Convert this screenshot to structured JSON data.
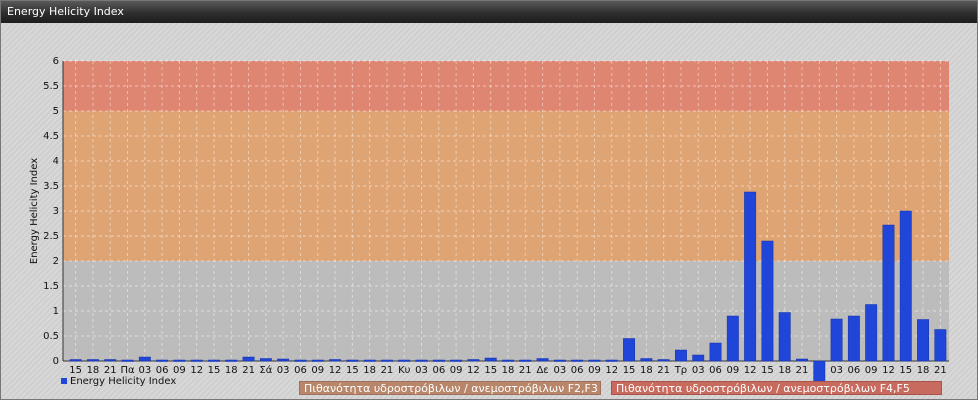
{
  "window": {
    "title": "Energy Helicity Index"
  },
  "chart_data": {
    "type": "bar",
    "ylabel": "Energy Helicity Index",
    "xlabel": "",
    "ylim": [
      0,
      6
    ],
    "yticks": [
      "0",
      "0.5",
      "1",
      "1.5",
      "2",
      "2.5",
      "3",
      "3.5",
      "4",
      "4.5",
      "5",
      "5.5",
      "6"
    ],
    "categories": [
      "15",
      "18",
      "21",
      "Πα",
      "03",
      "06",
      "09",
      "12",
      "15",
      "18",
      "21",
      "Σά",
      "03",
      "06",
      "09",
      "12",
      "15",
      "18",
      "21",
      "Κυ",
      "03",
      "06",
      "09",
      "12",
      "15",
      "18",
      "21",
      "Δε",
      "03",
      "06",
      "09",
      "12",
      "15",
      "18",
      "21",
      "Τρ",
      "03",
      "06",
      "09",
      "12",
      "15",
      "18",
      "21",
      "",
      "03",
      "06",
      "09",
      "12",
      "15",
      "18",
      "21"
    ],
    "series": [
      {
        "name": "Energy Helicity Index",
        "color": "#1f45d9",
        "values": [
          0.03,
          0.03,
          0.03,
          0.02,
          0.08,
          0.02,
          0.02,
          0.02,
          0.02,
          0.02,
          0.08,
          0.05,
          0.04,
          0.02,
          0.02,
          0.03,
          0.02,
          0.02,
          0.02,
          0.02,
          0.02,
          0.02,
          0.02,
          0.03,
          0.06,
          0.02,
          0.02,
          0.05,
          0.02,
          0.02,
          0.02,
          0.02,
          0.45,
          0.05,
          0.03,
          0.22,
          0.12,
          0.36,
          0.9,
          3.38,
          2.4,
          0.97,
          0.04,
          -0.62,
          0.84,
          0.9,
          1.13,
          2.72,
          3.0,
          0.83,
          0.63
        ]
      }
    ],
    "bands": [
      {
        "from": 2,
        "to": 5,
        "color": "#e5a067",
        "label": "Πιθανότητα υδροστρόβιλων / ανεμοστρόβιλων F2,F3"
      },
      {
        "from": 5,
        "to": 6,
        "color": "#e47c65",
        "label": "Πιθανότητα υδροστρόβιλων / ανεμοστρόβιλων F4,F5"
      }
    ],
    "grid": true,
    "legend_position": "bottom-left"
  }
}
